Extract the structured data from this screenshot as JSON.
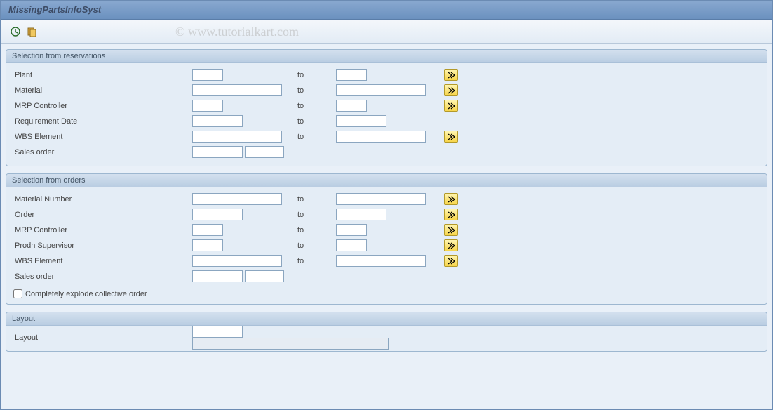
{
  "title": "MissingPartsInfoSyst",
  "watermark": "© www.tutorialkart.com",
  "to_label": "to",
  "groups": {
    "reservations": {
      "title": "Selection from reservations",
      "plant": "Plant",
      "material": "Material",
      "mrp": "MRP Controller",
      "reqdate": "Requirement Date",
      "wbs": "WBS Element",
      "salesorder": "Sales order"
    },
    "orders": {
      "title": "Selection from orders",
      "matnum": "Material Number",
      "order": "Order",
      "mrp": "MRP Controller",
      "prodn": "Prodn Supervisor",
      "wbs": "WBS Element",
      "salesorder": "Sales order",
      "explode": "Completely explode collective order"
    },
    "layout": {
      "title": "Layout",
      "layout": "Layout"
    }
  }
}
